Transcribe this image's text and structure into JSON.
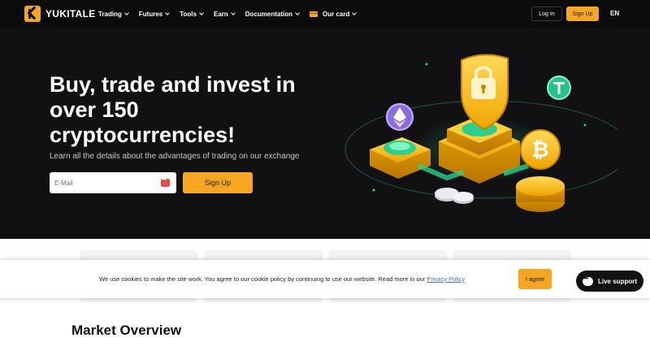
{
  "brand": {
    "name": "YUKITALE"
  },
  "nav": {
    "items": [
      {
        "label": "Trading"
      },
      {
        "label": "Futures"
      },
      {
        "label": "Tools"
      },
      {
        "label": "Earn"
      },
      {
        "label": "Documentation"
      },
      {
        "label": "Our card"
      }
    ],
    "login": "Log In",
    "signup": "Sign Up",
    "language": "EN"
  },
  "hero": {
    "title": "Buy, trade and invest in over 150 cryptocurrencies!",
    "subtitle": "Learn all the details about the advantages of trading on our exchange",
    "email_placeholder": "E-Mail",
    "signup": "Sign Up"
  },
  "cookie": {
    "text": "We use cookies to make the site work. You agree to our cookie policy by continuing to use our website. Read more in our ",
    "link": "Privacy Policy",
    "button": "I agree"
  },
  "support": {
    "label": "Live support"
  },
  "market": {
    "title": "Market Overview"
  },
  "colors": {
    "accent": "#f5a623",
    "hero_bg": "#111113",
    "nav_bg": "#0b0b0c"
  },
  "icons": [
    "logo-icon",
    "chevron-down-icon",
    "card-icon",
    "password-manager-icon",
    "shield-lock-icon",
    "ethereum-icon",
    "tether-icon",
    "bitcoin-icon",
    "chat-icon"
  ]
}
